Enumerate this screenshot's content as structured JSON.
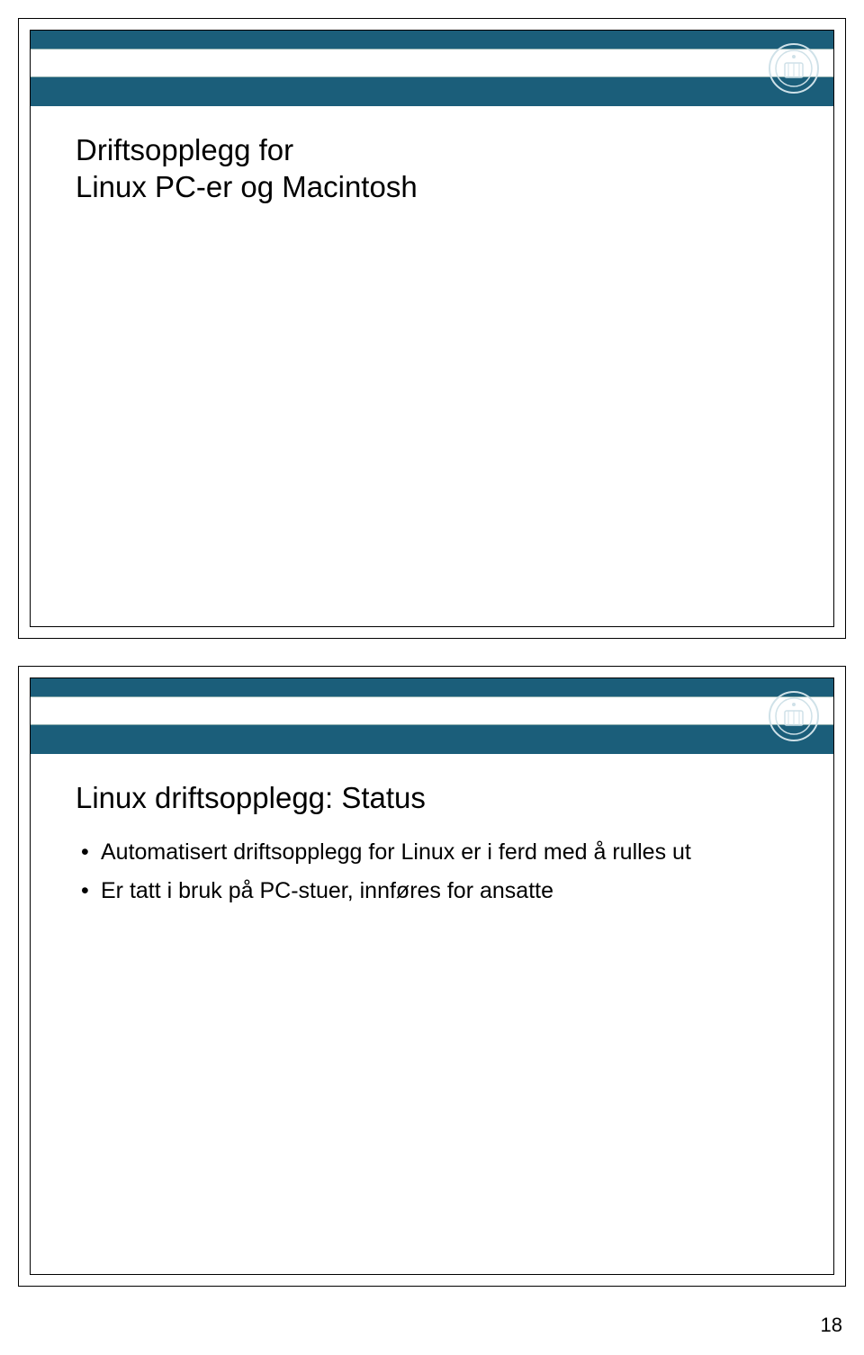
{
  "slides": [
    {
      "title": "Driftsopplegg for\nLinux PC-er og Macintosh",
      "bullets": []
    },
    {
      "title": "Linux driftsopplegg: Status",
      "bullets": [
        "Automatisert driftsopplegg for Linux er i ferd med å rulles ut",
        "Er tatt i bruk på PC-stuer, innføres for ansatte"
      ]
    }
  ],
  "page_number": "18"
}
